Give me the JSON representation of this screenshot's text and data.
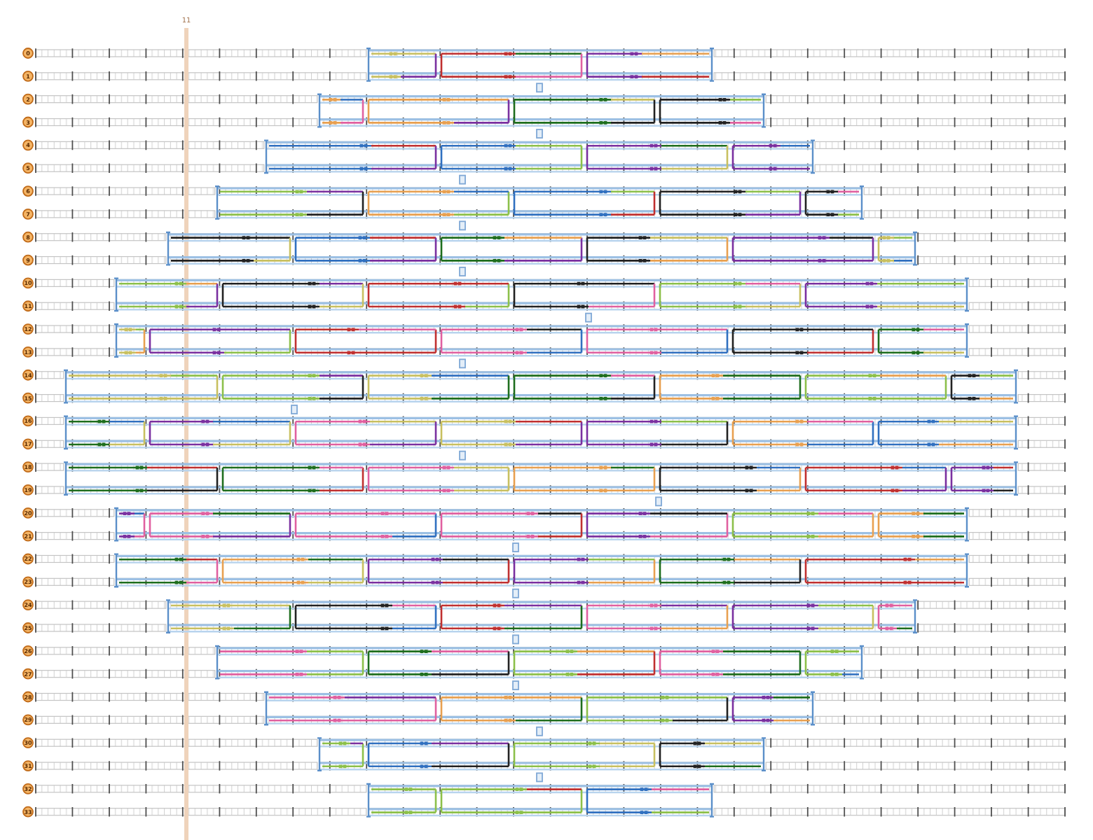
{
  "timeline": {
    "playhead": {
      "label": "11"
    },
    "tracks": [
      {
        "label": "0"
      },
      {
        "label": "1"
      },
      {
        "label": "2"
      },
      {
        "label": "3"
      },
      {
        "label": "4"
      },
      {
        "label": "5"
      },
      {
        "label": "6"
      },
      {
        "label": "7"
      },
      {
        "label": "8"
      },
      {
        "label": "9"
      },
      {
        "label": "10"
      },
      {
        "label": "11"
      },
      {
        "label": "12"
      },
      {
        "label": "13"
      },
      {
        "label": "14"
      },
      {
        "label": "15"
      },
      {
        "label": "16"
      },
      {
        "label": "17"
      },
      {
        "label": "18"
      },
      {
        "label": "19"
      },
      {
        "label": "20"
      },
      {
        "label": "21"
      },
      {
        "label": "22"
      },
      {
        "label": "23"
      },
      {
        "label": "24"
      },
      {
        "label": "25"
      },
      {
        "label": "26"
      },
      {
        "label": "27"
      },
      {
        "label": "28"
      },
      {
        "label": "29"
      },
      {
        "label": "30"
      },
      {
        "label": "31"
      },
      {
        "label": "32"
      },
      {
        "label": "33"
      }
    ]
  }
}
